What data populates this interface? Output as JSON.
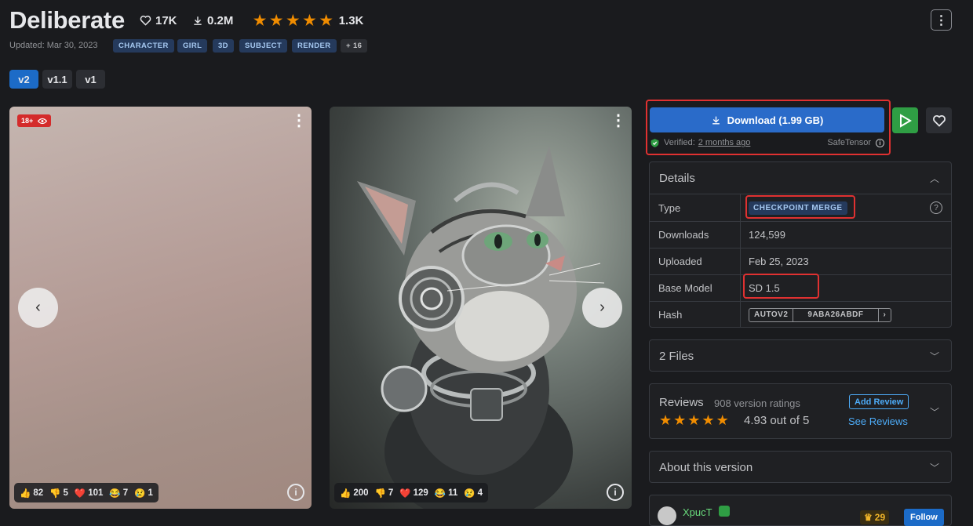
{
  "header": {
    "title": "Deliberate",
    "favorites": "17K",
    "downloads": "0.2M",
    "rating_count": "1.3K",
    "updated": "Updated: Mar 30, 2023",
    "tags": [
      "CHARACTER",
      "GIRL",
      "3D",
      "SUBJECT",
      "RENDER"
    ],
    "more_tags": "+ 16"
  },
  "versions": [
    "v2",
    "v1.1",
    "v1"
  ],
  "gallery": {
    "nsfw_badge": "18+",
    "card1_reactions": [
      "82",
      "5",
      "101",
      "7",
      "1"
    ],
    "card2_reactions": [
      "200",
      "7",
      "129",
      "11",
      "4"
    ],
    "reaction_icons": [
      "👍",
      "👎",
      "❤️",
      "😂",
      "😢"
    ]
  },
  "download": {
    "label": "Download (1.99 GB)",
    "verified_label": "Verified:",
    "verified_when": "2 months ago",
    "format": "SafeTensor"
  },
  "details": {
    "heading": "Details",
    "rows": [
      {
        "key": "Type",
        "value": "CHECKPOINT MERGE"
      },
      {
        "key": "Downloads",
        "value": "124,599"
      },
      {
        "key": "Uploaded",
        "value": "Feb 25, 2023"
      },
      {
        "key": "Base Model",
        "value": "SD 1.5"
      },
      {
        "key": "Hash",
        "value": ""
      }
    ],
    "hash_type": "AUTOV2",
    "hash_value": "9ABA26ABDF"
  },
  "files": {
    "label": "2 Files"
  },
  "reviews": {
    "heading": "Reviews",
    "ratings": "908 version ratings",
    "score": "4.93 out of 5",
    "add_label": "Add Review",
    "see_label": "See Reviews"
  },
  "about": {
    "label": "About this version"
  },
  "creator": {
    "name": "XpucT",
    "badge_count": "29",
    "follow_label": "Follow"
  },
  "colors": {
    "accent": "#2a6bc9",
    "play": "#2f9e44",
    "highlight": "#e03131",
    "star": "#f08c00"
  }
}
